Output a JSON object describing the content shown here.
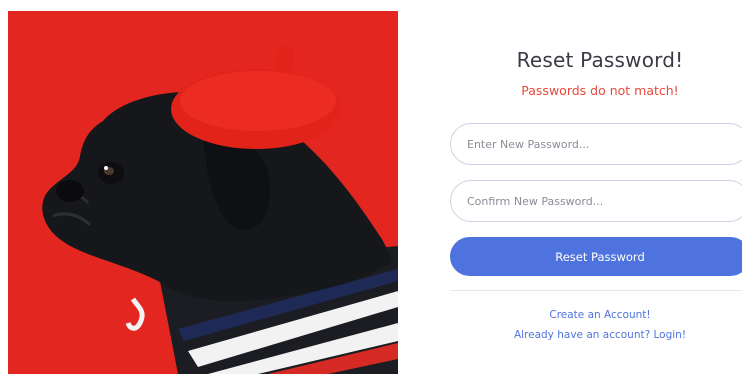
{
  "hero": {
    "image_name": "pug-in-red-beret-photo"
  },
  "form": {
    "title": "Reset Password!",
    "error_message": "Passwords do not match!",
    "new_password_placeholder": "Enter New Password...",
    "confirm_password_placeholder": "Confirm New Password...",
    "submit_label": "Reset Password"
  },
  "links": {
    "create_account": "Create an Account!",
    "login": "Already have an account? Login!"
  },
  "colors": {
    "primary": "#4e73df",
    "error": "#e74a3b",
    "title": "#3a3b45",
    "hero_background": "#e3261f"
  }
}
